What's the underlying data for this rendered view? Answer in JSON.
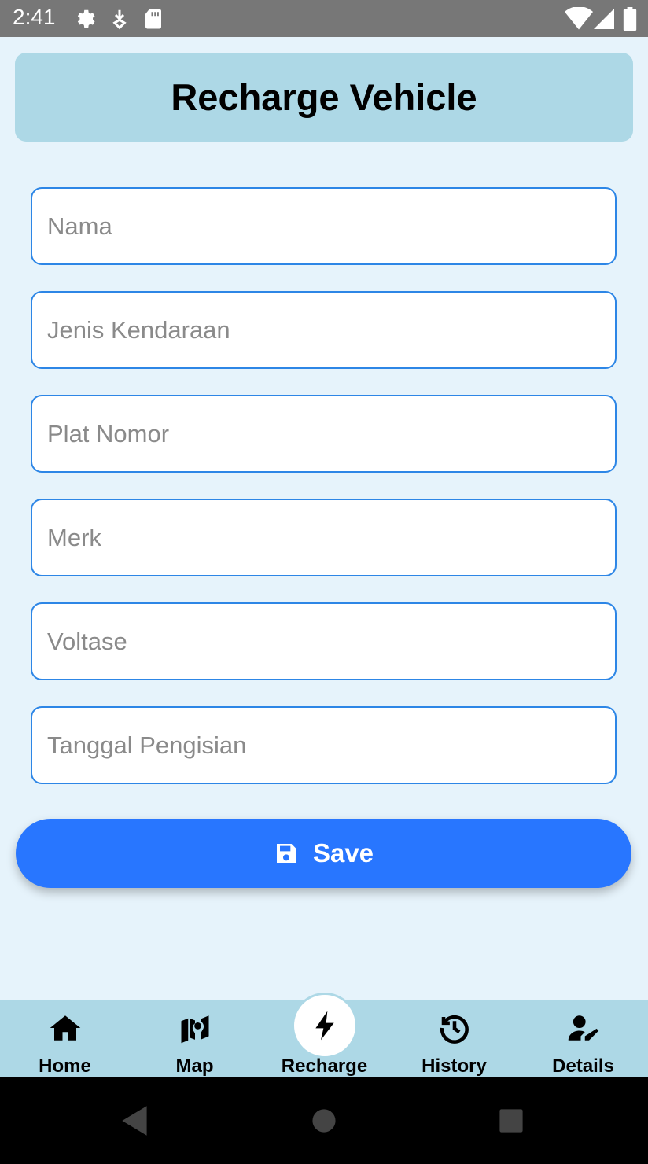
{
  "status_bar": {
    "time": "2:41",
    "icons": [
      "gear-icon",
      "download-icon",
      "sd-card-icon",
      "wifi-icon",
      "signal-icon",
      "battery-icon"
    ]
  },
  "header": {
    "title": "Recharge Vehicle"
  },
  "form": {
    "fields": [
      {
        "name": "nama",
        "placeholder": "Nama",
        "value": ""
      },
      {
        "name": "jenis-kendaraan",
        "placeholder": "Jenis Kendaraan",
        "value": ""
      },
      {
        "name": "plat-nomor",
        "placeholder": "Plat Nomor",
        "value": ""
      },
      {
        "name": "merk",
        "placeholder": "Merk",
        "value": ""
      },
      {
        "name": "voltase",
        "placeholder": "Voltase",
        "value": ""
      },
      {
        "name": "tanggal-pengisian",
        "placeholder": "Tanggal Pengisian",
        "value": ""
      }
    ],
    "save_label": "Save",
    "save_icon": "floppy-disk-icon"
  },
  "bottom_nav": {
    "active": "Recharge",
    "items": [
      {
        "label": "Home",
        "icon": "home-icon"
      },
      {
        "label": "Map",
        "icon": "map-icon"
      },
      {
        "label": "Recharge",
        "icon": "lightning-bolt-icon"
      },
      {
        "label": "History",
        "icon": "history-icon"
      },
      {
        "label": "Details",
        "icon": "user-edit-icon"
      }
    ]
  },
  "system_nav": {
    "buttons": [
      "back",
      "home",
      "recents"
    ]
  },
  "colors": {
    "background": "#e6f3fb",
    "header_bg": "#add8e6",
    "field_border": "#2d86e6",
    "save_button": "#2876ff",
    "status_bar": "#777777",
    "system_nav": "#000000"
  }
}
